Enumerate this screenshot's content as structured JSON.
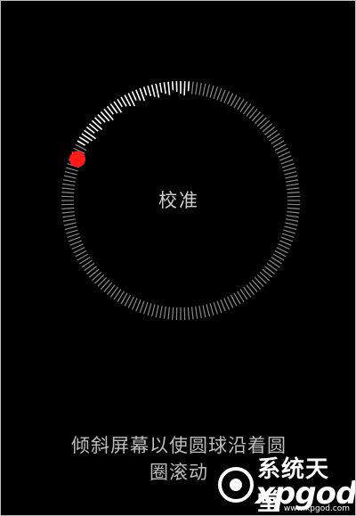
{
  "screen": {
    "title": "校准",
    "instruction_line1": "倾斜屏幕以使圆球沿着圆",
    "instruction_line2": "圈滚动"
  },
  "ring": {
    "tick_count": 180,
    "calibrated_sector_start_deg": 210,
    "calibrated_sector_end_deg": 275
  },
  "ball": {
    "color": "#ff1a1a",
    "angle_deg": 210
  },
  "watermark": {
    "cn": "系统天堂",
    "en": "xpgod",
    "url": "www.xpgod.com"
  },
  "colors": {
    "background": "#000000",
    "tick": "#8a8a8a",
    "tick_bright": "#ffffff",
    "text": "#cfcfcf"
  }
}
